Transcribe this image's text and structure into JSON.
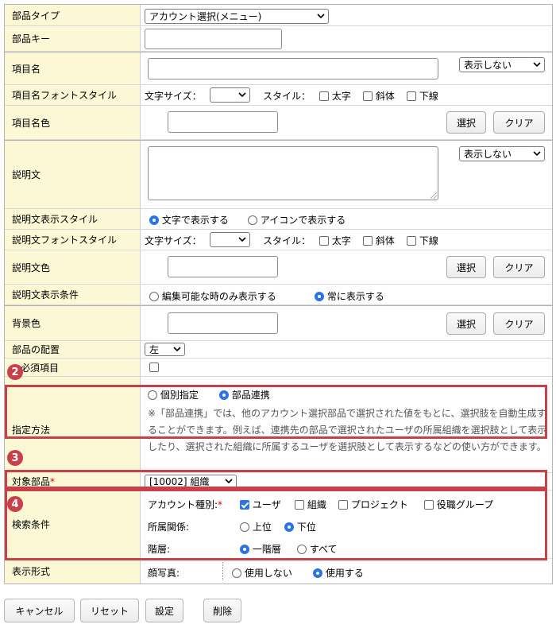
{
  "rows": {
    "part_type": {
      "label": "部品タイプ",
      "value": "アカウント選択(メニュー)"
    },
    "part_key": {
      "label": "部品キー",
      "value": ""
    },
    "item_name": {
      "label": "項目名",
      "value": "",
      "display": "表示しない"
    },
    "item_name_font": {
      "label": "項目名フォントスタイル",
      "size_label": "文字サイズ：",
      "size_value": "",
      "style_label": "スタイル：",
      "bold": "太字",
      "italic": "斜体",
      "underline": "下線"
    },
    "item_name_color": {
      "label": "項目名色",
      "value": "",
      "select": "選択",
      "clear": "クリア"
    },
    "description": {
      "label": "説明文",
      "value": "",
      "display": "表示しない"
    },
    "desc_display_style": {
      "label": "説明文表示スタイル",
      "opt_text": "文字で表示する",
      "opt_icon": "アイコンで表示する"
    },
    "desc_font": {
      "label": "説明文フォントスタイル",
      "size_label": "文字サイズ：",
      "size_value": "",
      "style_label": "スタイル：",
      "bold": "太字",
      "italic": "斜体",
      "underline": "下線"
    },
    "desc_color": {
      "label": "説明文色",
      "value": "",
      "select": "選択",
      "clear": "クリア"
    },
    "desc_condition": {
      "label": "説明文表示条件",
      "opt_editable": "編集可能な時のみ表示する",
      "opt_always": "常に表示する"
    },
    "bg_color": {
      "label": "背景色",
      "value": "",
      "select": "選択",
      "clear": "クリア"
    },
    "placement": {
      "label": "部品の配置",
      "value": "左"
    },
    "required": {
      "label": "必須項目"
    },
    "spec_method": {
      "label": "指定方法",
      "opt_individual": "個別指定",
      "opt_linked": "部品連携",
      "note": "※「部品連携」では、他のアカウント選択部品で選択された値をもとに、選択肢を自動生成することができます。例えば、連携先の部品で選択されたユーザの所属組織を選択肢として表示したり、選択された組織に所属するユーザを選択肢として表示するなどの使い方ができます。"
    },
    "target_part": {
      "label": "対象部品",
      "req": "*",
      "value": "[10002] 組織"
    },
    "search_cond": {
      "label": "検索条件",
      "account_type_label": "アカウント種別:",
      "req": "*",
      "user": "ユーザ",
      "org": "組織",
      "project": "プロジェクト",
      "role_group": "役職グループ",
      "relation_label": "所属関係:",
      "upper": "上位",
      "lower": "下位",
      "level_label": "階層:",
      "one_level": "一階層",
      "all": "すべて"
    },
    "display_format": {
      "label": "表示形式",
      "face_photo_label": "顔写真:",
      "not_use": "使用しない",
      "use": "使用する"
    }
  },
  "badges": {
    "b2": "2",
    "b3": "3",
    "b4": "4"
  },
  "footer": {
    "cancel": "キャンセル",
    "reset": "リセット",
    "set": "設定",
    "delete": "削除"
  },
  "colors": {
    "label_bg": "#fcf8d6",
    "highlight": "#c8404a",
    "accent": "#2a73e8"
  }
}
